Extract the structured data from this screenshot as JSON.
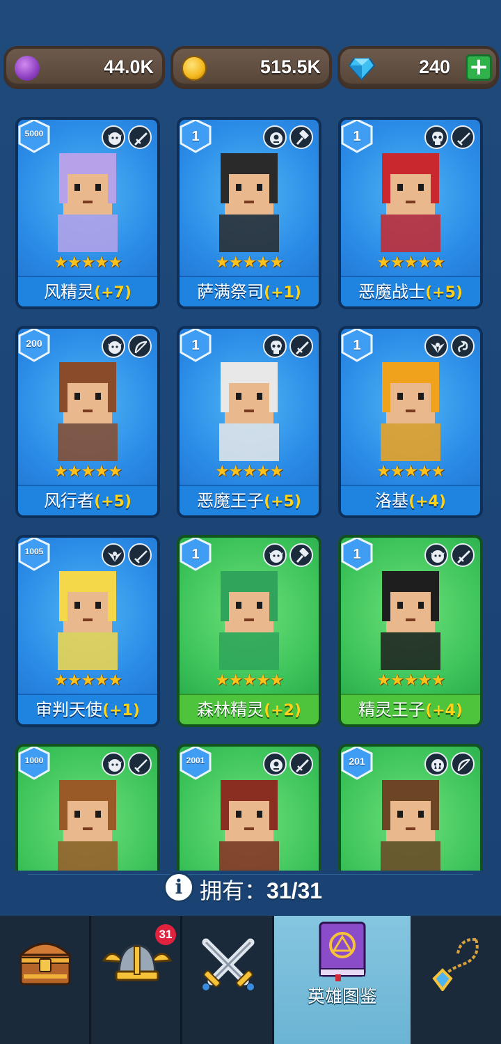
{
  "currencies": [
    {
      "name": "elixir",
      "value": "44.0K",
      "color": "#9b4fc9"
    },
    {
      "name": "gold",
      "value": "515.5K",
      "color": "#f3b81d"
    },
    {
      "name": "gems",
      "value": "240",
      "color": "#29a9e6",
      "add_label": "+"
    }
  ],
  "cards": [
    {
      "level": "5000",
      "name": "风精灵",
      "bonus": "(+7)",
      "stars": "★★★★★",
      "theme": "blue",
      "role_icon": "elf-icon",
      "weapon_icon": "dagger-icon",
      "hero_color": "#b6a2e8"
    },
    {
      "level": "1",
      "name": "萨满祭司",
      "bonus": "(+1)",
      "stars": "★★★★★",
      "theme": "blue",
      "role_icon": "cyclops-icon",
      "weapon_icon": "hammer-icon",
      "hero_color": "#2a2a2a"
    },
    {
      "level": "1",
      "name": "恶魔战士",
      "bonus": "(+5)",
      "stars": "★★★★★",
      "theme": "blue",
      "role_icon": "skull-icon",
      "weapon_icon": "sword-icon",
      "hero_color": "#c8282e"
    },
    {
      "level": "200",
      "name": "风行者",
      "bonus": "(+5)",
      "stars": "★★★★★",
      "theme": "blue",
      "role_icon": "elf-icon",
      "weapon_icon": "bow-icon",
      "hero_color": "#8a4b2a"
    },
    {
      "level": "1",
      "name": "恶魔王子",
      "bonus": "(+5)",
      "stars": "★★★★★",
      "theme": "blue",
      "role_icon": "skull-icon",
      "weapon_icon": "dagger-icon",
      "hero_color": "#e8e8e8"
    },
    {
      "level": "1",
      "name": "洛基",
      "bonus": "(+4)",
      "stars": "★★★★★",
      "theme": "blue",
      "role_icon": "wings-icon",
      "weapon_icon": "serpent-icon",
      "hero_color": "#f0a21c"
    },
    {
      "level": "1005",
      "name": "审判天使",
      "bonus": "(+1)",
      "stars": "★★★★★",
      "theme": "blue",
      "role_icon": "wings-icon",
      "weapon_icon": "sword-icon",
      "hero_color": "#f5d84a"
    },
    {
      "level": "1",
      "name": "森林精灵",
      "bonus": "(+2)",
      "stars": "★★★★★",
      "theme": "green",
      "role_icon": "elf-icon",
      "weapon_icon": "hammer-icon",
      "hero_color": "#2fa45a"
    },
    {
      "level": "1",
      "name": "精灵王子",
      "bonus": "(+4)",
      "stars": "★★★★★",
      "theme": "green",
      "role_icon": "elf-icon",
      "weapon_icon": "dagger-icon",
      "hero_color": "#1e1e1e"
    },
    {
      "level": "1000",
      "name": "",
      "bonus": "",
      "stars": "",
      "theme": "green",
      "role_icon": "elf-icon",
      "weapon_icon": "sword-icon",
      "hero_color": "#9a5a28"
    },
    {
      "level": "2001",
      "name": "",
      "bonus": "",
      "stars": "",
      "theme": "green",
      "role_icon": "cyclops-icon",
      "weapon_icon": "dagger-icon",
      "hero_color": "#8a2e22"
    },
    {
      "level": "201",
      "name": "",
      "bonus": "",
      "stars": "",
      "theme": "green",
      "role_icon": "orc-icon",
      "weapon_icon": "bow-icon",
      "hero_color": "#6b4524"
    }
  ],
  "owned": {
    "label": "拥有：",
    "count": "31/31",
    "info_icon": "info-icon"
  },
  "nav": [
    {
      "name": "chest-icon",
      "label": "",
      "badge": ""
    },
    {
      "name": "helmet-icon",
      "label": "",
      "badge": "31"
    },
    {
      "name": "crossed-swords-icon",
      "label": "",
      "badge": ""
    },
    {
      "name": "hero-book-icon",
      "label": "英雄图鉴",
      "badge": "",
      "active": true
    },
    {
      "name": "amulet-icon",
      "label": "",
      "badge": ""
    }
  ]
}
